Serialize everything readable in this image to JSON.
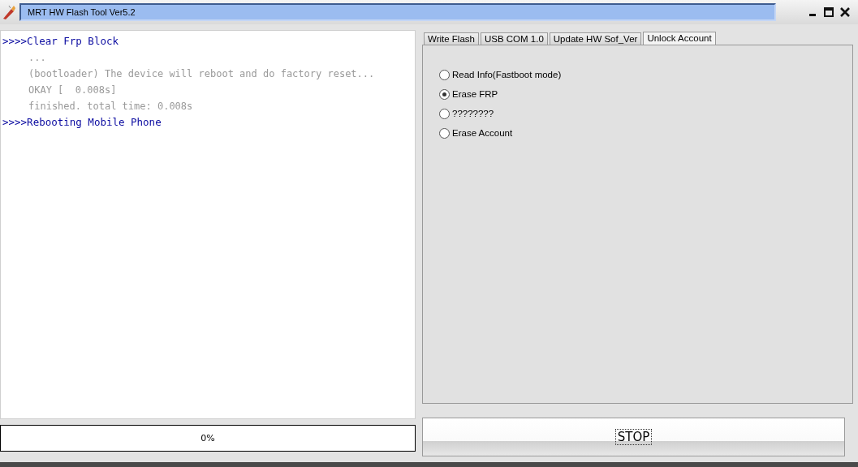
{
  "window": {
    "title": "MRT HW Flash Tool Ver5.2"
  },
  "log": [
    {
      "kind": "command",
      "text": ">>>>Clear Frp Block"
    },
    {
      "kind": "output",
      "text": "..."
    },
    {
      "kind": "output",
      "text": "(bootloader) The device will reboot and do factory reset..."
    },
    {
      "kind": "output",
      "text": "OKAY [  0.008s]"
    },
    {
      "kind": "output",
      "text": "finished. total time: 0.008s"
    },
    {
      "kind": "command",
      "text": ">>>>Rebooting Mobile Phone"
    }
  ],
  "tabs": [
    {
      "label": "Write Flash",
      "selected": false
    },
    {
      "label": "USB COM 1.0",
      "selected": false
    },
    {
      "label": "Update HW Sof_Ver",
      "selected": false
    },
    {
      "label": "Unlock Account",
      "selected": true
    }
  ],
  "options": [
    {
      "label": "Read Info(Fastboot mode)",
      "selected": false
    },
    {
      "label": "Erase FRP",
      "selected": true
    },
    {
      "label": "????????",
      "selected": false
    },
    {
      "label": "Erase Account",
      "selected": false
    }
  ],
  "progress": {
    "level": 0,
    "label": "0%"
  },
  "stop_button": {
    "label": "STOP"
  }
}
